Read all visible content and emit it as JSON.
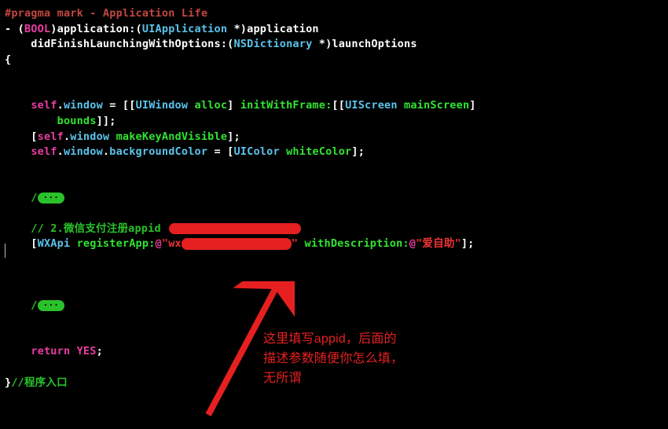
{
  "l1_pragma": "#pragma mark - Application Life",
  "l2_p1": "- (",
  "l2_bool": "BOOL",
  "l2_p2": ")application:(",
  "l2_uiapp": "UIApplication",
  "l2_p3": " *)application",
  "l3_p1": "    didFinishLaunchingWithOptions:(",
  "l3_nsdict": "NSDictionary",
  "l3_p2": " *)launchOptions",
  "l4": "{",
  "l7_p1": "    ",
  "l7_self": "self",
  "l7_p2": ".",
  "l7_win": "window",
  "l7_p3": " = [[",
  "l7_uiwin": "UIWindow",
  "l7_sp": " ",
  "l7_alloc": "alloc",
  "l7_p4": "] ",
  "l7_initframe": "initWithFrame:",
  "l7_p5": "[[",
  "l7_uiscr": "UIScreen",
  "l7_sp2": " ",
  "l7_mainscr": "mainScreen",
  "l7_p6": "]",
  "l8_indent": "        ",
  "l8_bounds": "bounds",
  "l8_p2": "]];",
  "l9_p1": "    [",
  "l9_self": "self",
  "l9_p2": ".",
  "l9_win": "window",
  "l9_sp": " ",
  "l9_make": "makeKeyAndVisible",
  "l9_p3": "];",
  "l10_p1": "    ",
  "l10_self": "self",
  "l10_p2": ".",
  "l10_win": "window",
  "l10_p3": ".",
  "l10_bg": "backgroundColor",
  "l10_p4": " = [",
  "l10_uicol": "UIColor",
  "l10_sp": " ",
  "l10_white": "whiteColor",
  "l10_p5": "];",
  "foldpre": "    /",
  "fold": "···",
  "cmt2_pre": "    // ",
  "cmt2": "2.微信支付注册appid ",
  "reg_p1": "    [",
  "reg_wxapi": "WXApi",
  "reg_sp": " ",
  "reg_sel": "registerApp:",
  "reg_at": "@",
  "reg_q1": "\"",
  "reg_wx": "wx",
  "reg_q2": "\"",
  "reg_sp2": " ",
  "reg_with": "withDescription:",
  "reg_at2": "@",
  "reg_s2": "\"爱自助\"",
  "reg_end": "];",
  "ret_p1": "    ",
  "ret": "return",
  "ret_sp": " ",
  "yes": "YES",
  "ret_p2": ";",
  "close_brace": "}",
  "close_cmt": "//程序入口",
  "annot1": "这里填写appid，后面的",
  "annot2": "描述参数随便你怎么填，",
  "annot3": "无所谓"
}
